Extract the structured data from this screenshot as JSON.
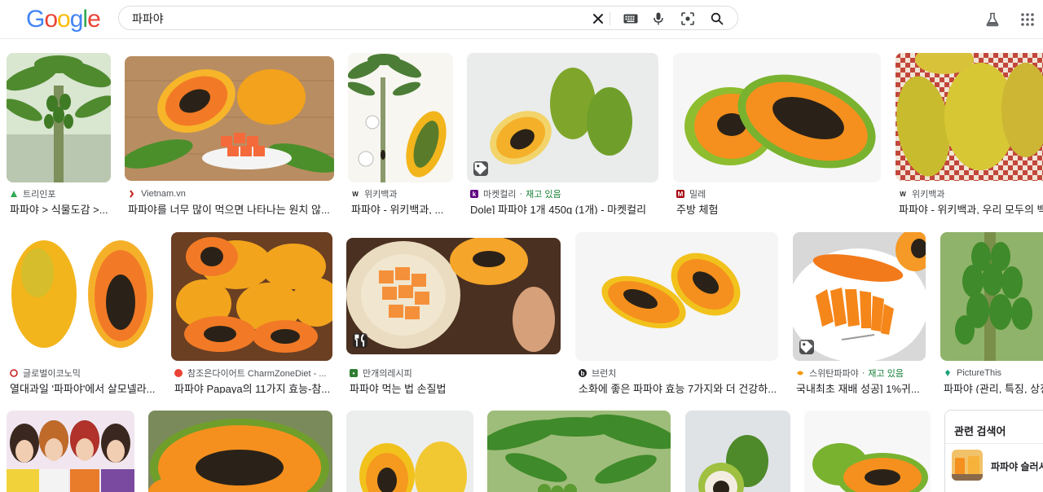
{
  "header": {
    "logo": "Google",
    "search_value": "파파야"
  },
  "colors": {
    "papaya_orange": "#f5902a",
    "papaya_yellow": "#f2b51c",
    "papaya_green": "#6f9f2a",
    "seed": "#2a2218",
    "stock_green": "#188038"
  },
  "results": [
    {
      "source": "트리인포",
      "title": "파파야 > 식물도감 >..."
    },
    {
      "source": "Vietnam.vn",
      "title": "파파야를 너무 많이 먹으면 나타나는 원치 않..."
    },
    {
      "source": "위키백과",
      "title": "파파야 - 위키백과, ..."
    },
    {
      "source": "마켓컬리",
      "stock": "재고 있음",
      "title": "Dole] 파파야 1개 450g (1개) - 마켓컬리"
    },
    {
      "source": "밀레",
      "title": "주방 체험"
    },
    {
      "source": "위키백과",
      "title": "파파야 - 위키백과, 우리 모두의 백과사전"
    },
    {
      "source": "글로벌이코노믹",
      "title": "열대과일 '파파야'에서 살모넬라..."
    },
    {
      "source": "참조은다이어트 CharmZoneDiet - ...",
      "title": "파파야 Papaya의 11가지 효능-참..."
    },
    {
      "source": "만개의레시피",
      "title": "파파야 먹는 법 손질법"
    },
    {
      "source": "브런치",
      "title": "소화에 좋은 파파야 효능 7가지와 더 건강하..."
    },
    {
      "source": "스위탄파파야",
      "stock": "재고 있음",
      "title": "국내최초 재배 성공] 1%귀..."
    },
    {
      "source": "PictureThis",
      "title": "파파야 (관리, 특징, 상징)"
    }
  ],
  "related": {
    "heading": "관련 검색어",
    "items": [
      {
        "label": "파파야 슬러시"
      }
    ]
  }
}
